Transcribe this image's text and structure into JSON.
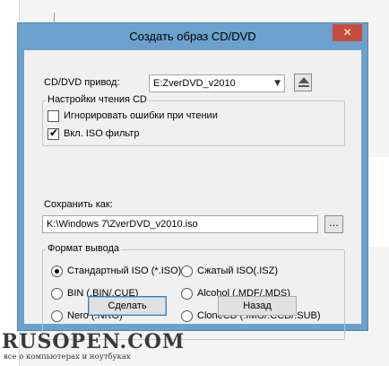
{
  "window": {
    "title": "Создать образ CD/DVD",
    "close_glyph": "✕"
  },
  "drive": {
    "label": "CD/DVD привод:",
    "selected": "E:ZverDVD_v2010",
    "dropdown_icon": "chevron-down-icon",
    "eject_icon": "eject-icon"
  },
  "read_settings": {
    "title": "Настройки чтения CD",
    "options": [
      {
        "label": "Игнорировать ошибки при чтении",
        "checked": false
      },
      {
        "label": "Вкл. ISO фильтр",
        "checked": true
      }
    ]
  },
  "save_as": {
    "label": "Сохранить как:",
    "value": "K:\\Windows 7\\ZverDVD_v2010.iso",
    "browse_label": "..."
  },
  "output_format": {
    "title": "Формат вывода",
    "options": [
      {
        "label": "Стандартный ISO (*.ISO)",
        "selected": true
      },
      {
        "label": "Сжатый ISO(.ISZ)",
        "selected": false
      },
      {
        "label": "BIN (.BIN/.CUE)",
        "selected": false
      },
      {
        "label": "Alcohol (.MDF/.MDS)",
        "selected": false
      },
      {
        "label": "Nero (.NRG)",
        "selected": false
      },
      {
        "label": "CloneCD (.IMG/.CCD/.SUB)",
        "selected": false
      }
    ]
  },
  "buttons": {
    "ok_label": "Сделать",
    "back_label": "Назад"
  },
  "watermark": {
    "title": "RUSOPEN.COM",
    "subtitle": "все о компьютерах и ноутбуках"
  }
}
